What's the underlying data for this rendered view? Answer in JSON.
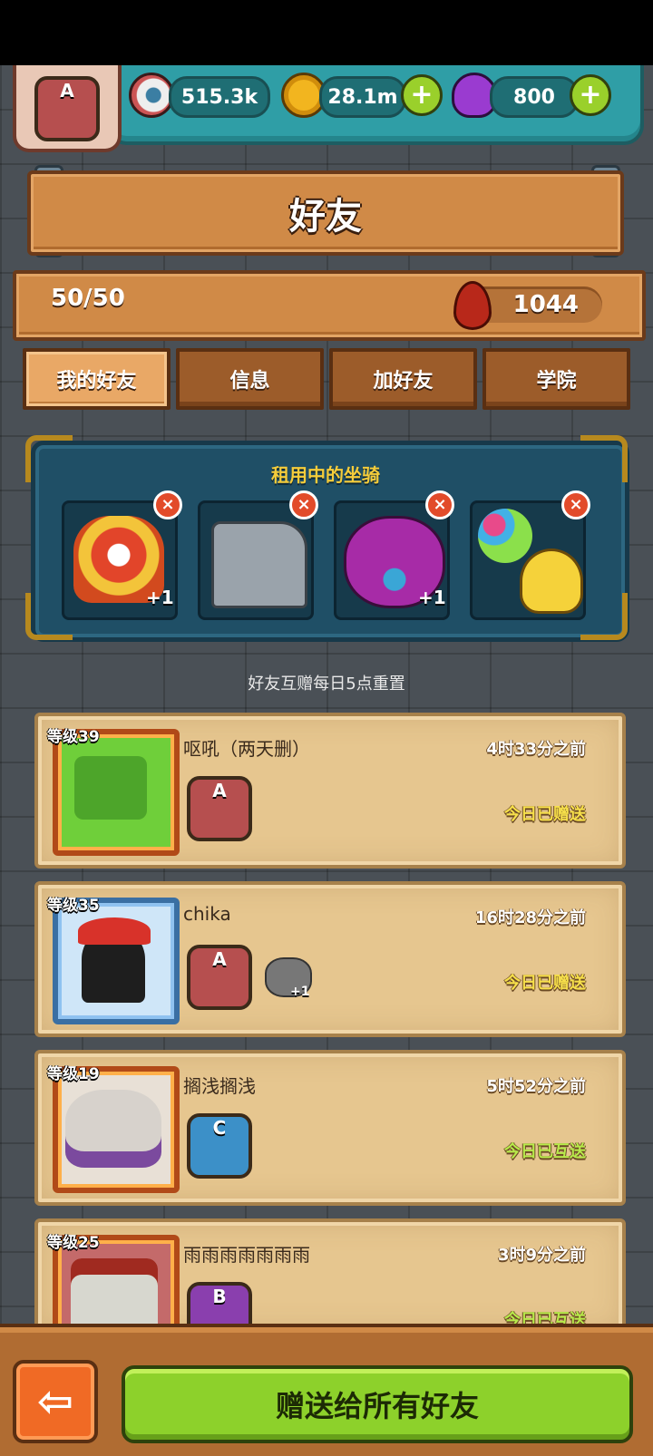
{
  "resources": {
    "eyeballs": "515.3k",
    "coins": "28.1m",
    "potions": "800",
    "plus": "+",
    "profile_rank": "A"
  },
  "header": {
    "title": "好友"
  },
  "friends_count": "50/50",
  "blood_points": "1044",
  "tabs": [
    {
      "label": "我的好友",
      "active": true
    },
    {
      "label": "信息"
    },
    {
      "label": "加好友"
    },
    {
      "label": "学院"
    }
  ],
  "mounts": {
    "title": "租用中的坐骑",
    "close": "×",
    "slots": [
      {
        "icon": "lion-dance-icon",
        "bonus": "+1"
      },
      {
        "icon": "mech-chair-icon",
        "bonus": ""
      },
      {
        "icon": "purple-monster-icon",
        "bonus": "+1"
      },
      {
        "icon": "balloon-duck-icon",
        "bonus": ""
      }
    ]
  },
  "reset_note": "好友互赠每日5点重置",
  "friends": [
    {
      "level": "等级39",
      "name": "呕吼（两天删）",
      "time": "4时33分之前",
      "status": "今日已赠送",
      "rank": "A",
      "extra_bonus": ""
    },
    {
      "level": "等级35",
      "name": "chika",
      "time": "16时28分之前",
      "status": "今日已赠送",
      "rank": "A",
      "extra_bonus": "+1"
    },
    {
      "level": "等级19",
      "name": "搁浅搁浅",
      "time": "5时52分之前",
      "status": "今日已互送",
      "rank": "C",
      "extra_bonus": ""
    },
    {
      "level": "等级25",
      "name": "雨雨雨雨雨雨雨",
      "time": "3时9分之前",
      "status": "今日已互送",
      "rank": "B",
      "extra_bonus": ""
    }
  ],
  "bottom": {
    "back": "⇦",
    "gift_all": "赠送给所有好友"
  }
}
